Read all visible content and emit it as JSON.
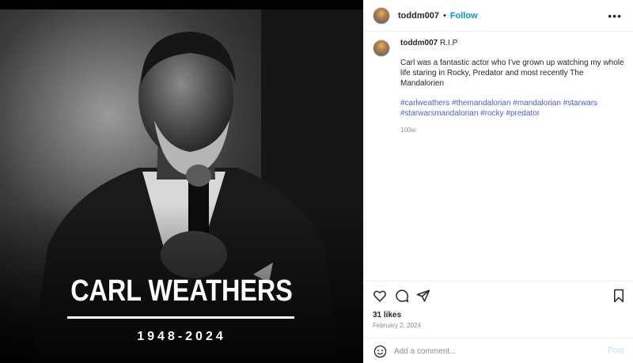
{
  "media": {
    "memorial_name": "CARL WEATHERS",
    "memorial_years": "1948-2024"
  },
  "header": {
    "username": "toddm007",
    "separator": "•",
    "follow_label": "Follow",
    "more_label": "•••"
  },
  "caption": {
    "username": "toddm007",
    "title": "R.I.P",
    "text": "Carl was a fantastic actor who I've grown up watching my whole life staring in Rocky, Predator and most recently The Mandalorien",
    "hashtags_line1": "#carlweathers #themandalorian #mandalorian #starwars",
    "hashtags_line2": "#starwarsmandalorian #rocky #predator",
    "time_ago": "100w"
  },
  "actions": {
    "icons": [
      "heart-icon",
      "comment-icon",
      "share-icon",
      "bookmark-icon"
    ]
  },
  "stats": {
    "likes": "31 likes",
    "date": "February 2, 2024"
  },
  "comment": {
    "placeholder": "Add a comment...",
    "post_label": "Post"
  },
  "colors": {
    "follow": "#0095f6",
    "hashtag": "#4a5fd0",
    "post_disabled": "#b2dffc"
  }
}
